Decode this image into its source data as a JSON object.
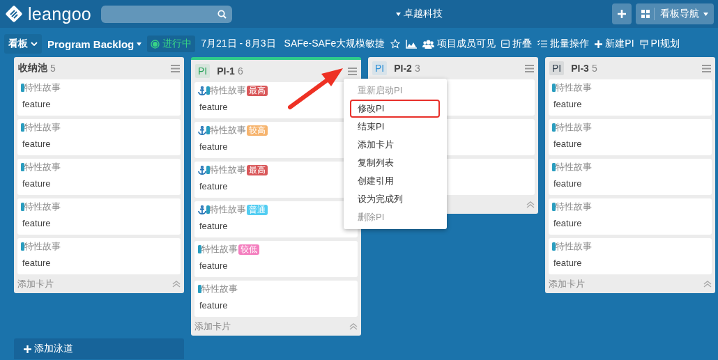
{
  "topbar": {
    "logo": "leangoo",
    "workspace": "卓越科技",
    "nav_button": "看板导航"
  },
  "toolbar": {
    "view": "看板",
    "board": "Program Backlog",
    "status": "进行中",
    "dates": "7月21日 - 8月3日",
    "template": "SAFe-SAFe大规模敏捷",
    "visibility": "项目成员可见",
    "collapse": "折叠",
    "batch": "批量操作",
    "new_pi": "新建PI",
    "pi_plan": "PI规划"
  },
  "columns": [
    {
      "title": "收纳池",
      "count": "5",
      "active": false,
      "add_card": "添加卡片",
      "cards": [
        {
          "kind": "story",
          "type": "特性故事",
          "title": "feature",
          "anchored": false
        },
        {
          "kind": "story",
          "type": "特性故事",
          "title": "feature",
          "anchored": false
        },
        {
          "kind": "story",
          "type": "特性故事",
          "title": "feature",
          "anchored": false
        },
        {
          "kind": "story",
          "type": "特性故事",
          "title": "feature",
          "anchored": false
        },
        {
          "kind": "story",
          "type": "特性故事",
          "title": "feature",
          "anchored": false
        }
      ]
    },
    {
      "tag": "PI",
      "color": "#27a35a",
      "title": "PI-1",
      "count": "6",
      "active": true,
      "add_card": "添加卡片",
      "cards": [
        {
          "kind": "story",
          "type": "特性故事",
          "title": "feature",
          "anchored": true,
          "priority": {
            "label": "最高",
            "color": "#d9585a"
          }
        },
        {
          "kind": "story",
          "type": "特性故事",
          "title": "feature",
          "anchored": true,
          "priority": {
            "label": "较高",
            "color": "#f6b46e"
          }
        },
        {
          "kind": "story",
          "type": "特性故事",
          "title": "feature",
          "anchored": true,
          "priority": {
            "label": "最高",
            "color": "#d9585a"
          }
        },
        {
          "kind": "story",
          "type": "特性故事",
          "title": "feature",
          "anchored": true,
          "priority": {
            "label": "普通",
            "color": "#52cdf2"
          }
        },
        {
          "kind": "story",
          "type": "特性故事",
          "title": "feature",
          "anchored": false,
          "priority": {
            "label": "较低",
            "color": "#f47fbf"
          }
        },
        {
          "kind": "story",
          "type": "特性故事",
          "title": "feature",
          "anchored": false
        }
      ]
    },
    {
      "tag": "PI",
      "color": "#2b8fd6",
      "title": "PI-2",
      "count": "3",
      "active": false,
      "cards": [
        {
          "kind": "covered"
        },
        {
          "kind": "covered"
        },
        {
          "kind": "covered"
        }
      ]
    },
    {
      "tag": "PI",
      "color": "#33414f",
      "title": "PI-3",
      "count": "5",
      "active": false,
      "add_card": "添加卡片",
      "cards": [
        {
          "kind": "story",
          "type": "特性故事",
          "title": "feature",
          "anchored": false
        },
        {
          "kind": "story",
          "type": "特性故事",
          "title": "feature",
          "anchored": false
        },
        {
          "kind": "story",
          "type": "特性故事",
          "title": "feature",
          "anchored": false
        },
        {
          "kind": "story",
          "type": "特性故事",
          "title": "feature",
          "anchored": false
        },
        {
          "kind": "story",
          "type": "特性故事",
          "title": "feature",
          "anchored": false
        }
      ]
    }
  ],
  "menu": {
    "items": [
      {
        "label": "重新启动PI",
        "disabled": true,
        "highlighted": false
      },
      {
        "label": "修改PI",
        "disabled": false,
        "highlighted": true
      },
      {
        "label": "结束PI",
        "disabled": false,
        "highlighted": false
      },
      {
        "label": "添加卡片",
        "disabled": false,
        "highlighted": false
      },
      {
        "label": "复制列表",
        "disabled": false,
        "highlighted": false
      },
      {
        "label": "创建引用",
        "disabled": false,
        "highlighted": false
      },
      {
        "label": "设为完成列",
        "disabled": false,
        "highlighted": false
      },
      {
        "label": "删除PI",
        "disabled": true,
        "highlighted": false
      }
    ]
  },
  "add_swimlane": "添加泳道"
}
